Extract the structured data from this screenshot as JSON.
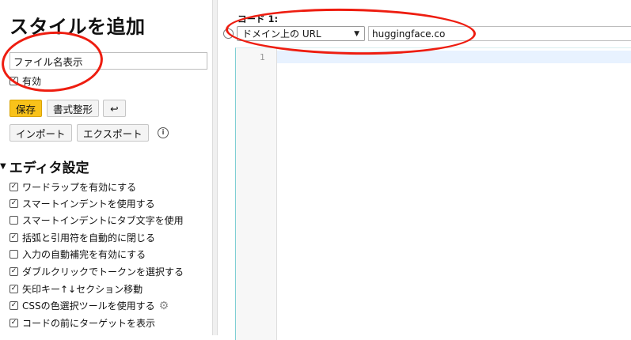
{
  "sidebar": {
    "title": "スタイルを追加",
    "name_value": "ファイル名表示",
    "enabled_label": "有効",
    "enabled_checked": true,
    "save_label": "保存",
    "format_label": "書式整形",
    "undo_icon": "↩",
    "import_label": "インポート",
    "export_label": "エクスポート",
    "info_icon": "i",
    "editor_settings_title": "エディタ設定",
    "options": [
      {
        "label": "ワードラップを有効にする",
        "checked": true
      },
      {
        "label": "スマートインデントを使用する",
        "checked": true
      },
      {
        "label": "スマートインデントにタブ文字を使用",
        "checked": false
      },
      {
        "label": "括弧と引用符を自動的に閉じる",
        "checked": true
      },
      {
        "label": "入力の自動補完を有効にする",
        "checked": false
      },
      {
        "label": "ダブルクリックでトークンを選択する",
        "checked": true
      },
      {
        "label": "矢印キー↑↓セクション移動",
        "checked": true
      },
      {
        "label": "CSSの色選択ツールを使用する",
        "checked": true
      },
      {
        "label": "コードの前にターゲットを表示",
        "checked": true
      }
    ]
  },
  "editor": {
    "code_label": "コード 1:",
    "match_type": "ドメイン上の URL",
    "url_value": "huggingface.co",
    "line_number": "1"
  },
  "colors": {
    "accent_button": "#f9c21a",
    "annotation": "#ee1d10",
    "editor_border": "#7ecfd4"
  }
}
